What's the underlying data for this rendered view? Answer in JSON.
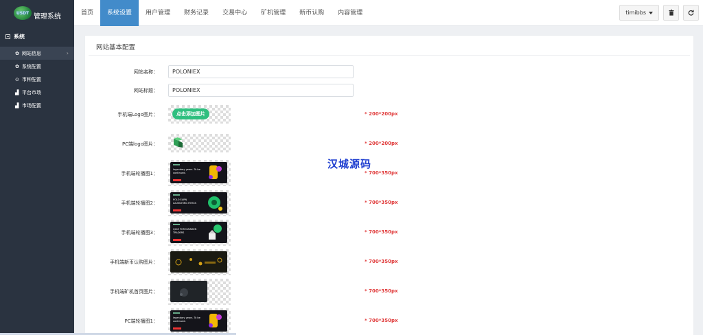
{
  "brand": {
    "logo_text": "USDT",
    "title": "管理系统"
  },
  "topnav": {
    "items": [
      {
        "label": "首页",
        "active": false
      },
      {
        "label": "系统设置",
        "active": true
      },
      {
        "label": "用户管理",
        "active": false
      },
      {
        "label": "财务记录",
        "active": false
      },
      {
        "label": "交易中心",
        "active": false
      },
      {
        "label": "矿机管理",
        "active": false
      },
      {
        "label": "新币认购",
        "active": false
      },
      {
        "label": "内容管理",
        "active": false
      }
    ],
    "user": "timibbs",
    "actions": [
      {
        "icon": "trash-icon"
      },
      {
        "icon": "refresh-icon"
      }
    ]
  },
  "sidebar": {
    "section": "系统",
    "items": [
      {
        "label": "网站信息",
        "icon": "gear-icon",
        "active": true
      },
      {
        "label": "系统配置",
        "icon": "gear-icon",
        "active": false
      },
      {
        "label": "币种配置",
        "icon": "circle-icon",
        "active": false
      },
      {
        "label": "平台市场",
        "icon": "bar-chart-icon",
        "active": false
      },
      {
        "label": "市场配置",
        "icon": "bar-chart-icon",
        "active": false
      }
    ]
  },
  "panel": {
    "title": "网站基本配置",
    "fields": [
      {
        "label": "网站名称：",
        "value": "POLONIEX"
      },
      {
        "label": "网站标题：",
        "value": "POLONIEX"
      }
    ],
    "images": [
      {
        "label": "手机端Logo图片：",
        "hint": "* 200*200px",
        "kind": "upload",
        "button": "点击添加图片"
      },
      {
        "label": "PC端logo图片：",
        "hint": "* 200*200px",
        "kind": "logo"
      },
      {
        "label": "手机端轮播图1：",
        "hint": "* 700*350px",
        "kind": "banner",
        "text": "legendary years. To be continued."
      },
      {
        "label": "手机端轮播图2：",
        "hint": "* 700*350px",
        "kind": "banner",
        "text": "POLO EARN LAUNCHING FIESTA"
      },
      {
        "label": "手机端轮播图3：",
        "hint": "* 700*350px",
        "kind": "banner",
        "text": "QUIZ FOR MAINSEN TRADERS"
      },
      {
        "label": "手机端新币认购图片：",
        "hint": "* 700*350px",
        "kind": "banner",
        "text": ""
      },
      {
        "label": "手机端矿机首页图片：",
        "hint": "* 700*350px",
        "kind": "banner",
        "text": ""
      },
      {
        "label": "PC端轮播图1：",
        "hint": "* 700*350px",
        "kind": "banner",
        "text": "legendary years. To be continued."
      }
    ]
  },
  "watermark": "汉城源码",
  "colors": {
    "sidebar_bg": "#2a3340",
    "accent": "#428bca",
    "hint": "#e03a3a",
    "upload_btn": "#2fbf7f"
  }
}
